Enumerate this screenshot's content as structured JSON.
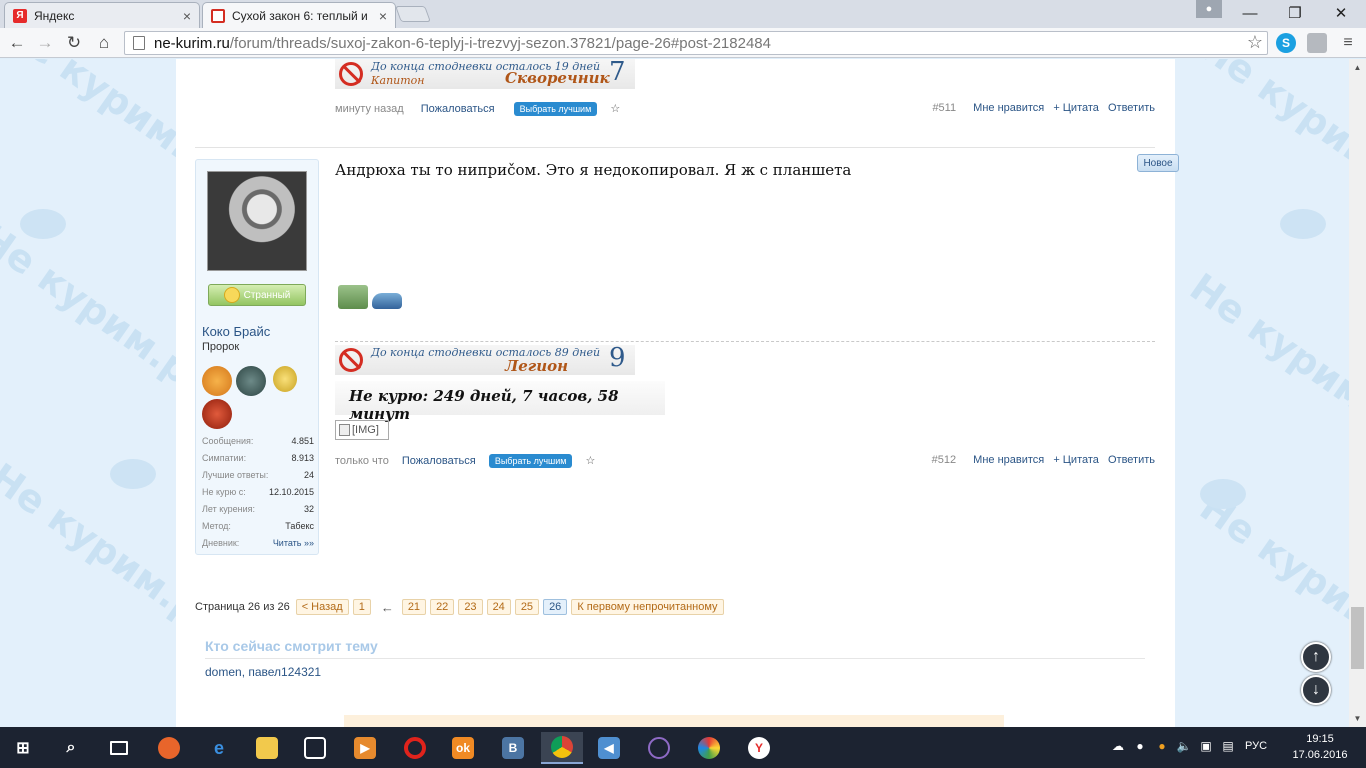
{
  "browser": {
    "tabs": [
      {
        "title": "Яндекс",
        "icon": "yandex-icon"
      },
      {
        "title": "Сухой закон 6: теплый и",
        "icon": "site-favicon"
      }
    ],
    "url_host": "ne-kurim.ru",
    "url_path": "/forum/threads/suxoj-zakon-6-teplyj-i-trezvyj-sezon.37821/page-26#post-2182484"
  },
  "background_logo": "Не курим.ру",
  "post511": {
    "banner": {
      "line1": "До конца стодневки осталось 19 дней",
      "line2": "Капитон",
      "rank": "Скворечник",
      "level": "7"
    },
    "date": "минуту назад",
    "report": "Пожаловаться",
    "best": "Выбрать лучшим",
    "star": "☆",
    "number": "#511",
    "like": "Мне нравится",
    "quote": "+ Цитата",
    "reply": "Ответить"
  },
  "post512": {
    "new_badge": "Новое",
    "user": {
      "status": "Странный",
      "name": "Коко Брайс",
      "title": "Пророк",
      "stats": [
        {
          "label": "Сообщения:",
          "value": "4.851"
        },
        {
          "label": "Симпатии:",
          "value": "8.913"
        },
        {
          "label": "Лучшие ответы:",
          "value": "24"
        },
        {
          "label": "Не курю с:",
          "value": "12.10.2015"
        },
        {
          "label": "Лет курения:",
          "value": "32"
        },
        {
          "label": "Метод:",
          "value": "Табекс"
        },
        {
          "label": "Дневник:",
          "value": "Читать »»"
        }
      ]
    },
    "text": "Андрюха ты то ниприčом. Это я недокопировал. Я ж с планшета",
    "banner": {
      "line1": "До конца стодневки осталось 89 дней",
      "rank": "Легион",
      "level": "9"
    },
    "nosmoke": "Не курю: 249 дней, 7 часов, 58 минут",
    "img_alt": "[IMG]",
    "date": "только что",
    "report": "Пожаловаться",
    "best": "Выбрать лучшим",
    "star": "☆",
    "number": "#512",
    "like": "Мне нравится",
    "quote": "+ Цитата",
    "reply": "Ответить"
  },
  "pagination": {
    "label": "Страница 26 из 26",
    "prev": "< Назад",
    "first": "1",
    "arrow": "←",
    "pages": [
      "21",
      "22",
      "23",
      "24",
      "25",
      "26"
    ],
    "current": "26",
    "unread": "К первому непрочитанному"
  },
  "watchers": {
    "heading": "Кто сейчас смотрит тему",
    "users": "domen, павел124321"
  },
  "taskbar": {
    "lang": "РУС",
    "time": "19:15",
    "date": "17.06.2016"
  },
  "colors": {
    "link": "#2b5586",
    "accent_button": "#2a8bd0",
    "page_bg": "#e3f0fb"
  }
}
